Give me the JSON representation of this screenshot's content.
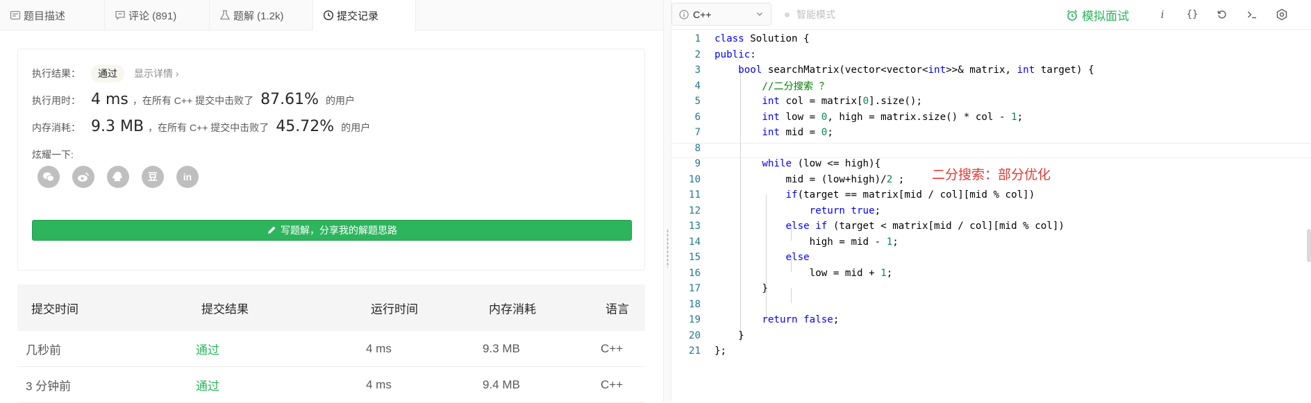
{
  "tabs": [
    {
      "label": "题目描述",
      "icon": "description-icon"
    },
    {
      "label": "评论 (891)",
      "icon": "comment-icon"
    },
    {
      "label": "题解 (1.2k)",
      "icon": "flask-icon"
    },
    {
      "label": "提交记录",
      "icon": "clock-icon"
    }
  ],
  "result": {
    "label": "执行结果：",
    "status": "通过",
    "detail": "显示详情 ›",
    "runtime_label": "执行用时：",
    "runtime_value": "4 ms",
    "runtime_mid": "，在所有 C++ 提交中击败了",
    "runtime_pct": "87.61%",
    "runtime_tail": "的用户",
    "memory_label": "内存消耗：",
    "memory_value": "9.3 MB",
    "memory_mid": "，在所有 C++ 提交中击败了",
    "memory_pct": "45.72%",
    "memory_tail": "的用户",
    "share_label": "炫耀一下:",
    "share_icons": [
      "wechat-icon",
      "weibo-icon",
      "qq-icon",
      "douban-icon",
      "linkedin-icon"
    ],
    "douban_glyph": "豆",
    "linkedin_glyph": "in",
    "write_button": "写题解，分享我的解题思路"
  },
  "table": {
    "headers": [
      "提交时间",
      "提交结果",
      "运行时间",
      "内存消耗",
      "语言"
    ],
    "rows": [
      [
        "几秒前",
        "通过",
        "4 ms",
        "9.3 MB",
        "C++"
      ],
      [
        "3 分钟前",
        "通过",
        "4 ms",
        "9.4 MB",
        "C++"
      ]
    ]
  },
  "toolbar": {
    "language": "C++",
    "smart_mode": "智能模式",
    "mock_interview": "模拟面试",
    "icons": [
      "info-icon",
      "braces-icon",
      "reset-icon",
      "terminal-icon",
      "settings-icon"
    ],
    "info_glyph": "i",
    "braces_glyph": "{}"
  },
  "editor": {
    "annotation": "二分搜索：部分优化",
    "line_numbers": [
      "1",
      "2",
      "3",
      "4",
      "5",
      "6",
      "7",
      "8",
      "9",
      "10",
      "11",
      "12",
      "13",
      "14",
      "15",
      "16",
      "17",
      "18",
      "19",
      "20",
      "21"
    ],
    "lines": [
      "class Solution {",
      "public:",
      "    bool searchMatrix(vector<vector<int>>& matrix, int target) {",
      "        //二分搜索 ？",
      "        int col = matrix[0].size();",
      "        int low = 0, high = matrix.size() * col - 1;",
      "        int mid = 0;",
      "",
      "        while (low <= high){",
      "            mid = (low+high)/2 ;",
      "            if(target == matrix[mid / col][mid % col])",
      "                return true;",
      "            else if (target < matrix[mid / col][mid % col])",
      "                high = mid - 1;",
      "            else",
      "                low = mid + 1;",
      "        }",
      "",
      "        return false;",
      "    }",
      "};"
    ]
  }
}
